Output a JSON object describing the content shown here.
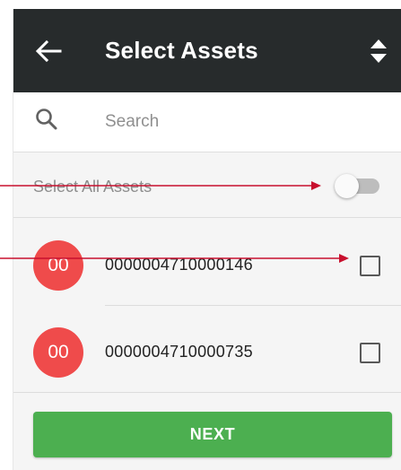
{
  "appbar": {
    "title": "Select Assets",
    "back_icon": "arrow-left-icon",
    "sort_icon": "sort-updown-icon",
    "background_color": "#272b2c"
  },
  "search": {
    "placeholder": "Search",
    "icon": "search-icon"
  },
  "select_all": {
    "label": "Select All Assets",
    "toggle_on": false
  },
  "assets": [
    {
      "avatar_text": "00",
      "asset_id": "0000004710000146",
      "checked": false
    },
    {
      "avatar_text": "00",
      "asset_id": "0000004710000735",
      "checked": false
    }
  ],
  "avatar_color": "#ef4b4b",
  "next_button": {
    "label": "NEXT",
    "color": "#4caf50"
  },
  "annotation_color": "#c8102e"
}
